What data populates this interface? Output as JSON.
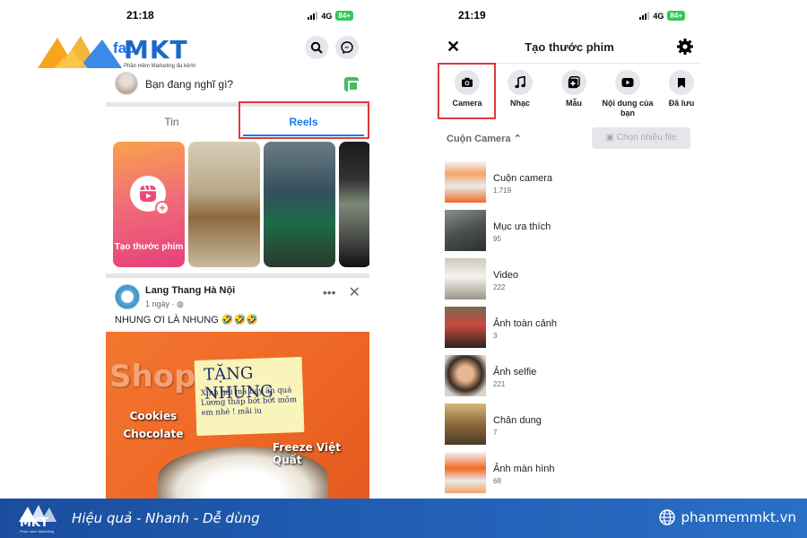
{
  "left_phone": {
    "status": {
      "time": "21:18",
      "network": "4G",
      "battery": "84+"
    },
    "brand": {
      "fb_text": "fac",
      "mkt_text": "MKT",
      "tagline": "Phần mềm Marketing đa kênh"
    },
    "composer": {
      "placeholder": "Bạn đang nghĩ gì?"
    },
    "tabs": [
      {
        "label": "Tin"
      },
      {
        "label": "Reels"
      }
    ],
    "reels": {
      "create_label": "Tạo thước phim"
    },
    "post": {
      "author": "Lang Thang Hà Nội",
      "time": "1 ngày · ",
      "caption": "NHUNG ƠI LÀ NHUNG 🤣🤣🤣",
      "image_text": {
        "brand": "Shope",
        "note_title": "TẶNG NHUNG",
        "note_body": "Xinh gái mà hay ăn quá Lương thấp bớt bớt mồm em nhé ! mãi iu",
        "cookies": "Cookies Chocolate",
        "freeze": "Freeze Việt Quất"
      }
    }
  },
  "right_phone": {
    "status": {
      "time": "21:19",
      "network": "4G",
      "battery": "84+"
    },
    "title": "Tạo thước phim",
    "categories": [
      {
        "label": "Camera",
        "icon": "camera-icon"
      },
      {
        "label": "Nhạc",
        "icon": "music-icon"
      },
      {
        "label": "Mẫu",
        "icon": "template-icon"
      },
      {
        "label": "Nội dung của bạn",
        "icon": "play-icon"
      },
      {
        "label": "Đã lưu",
        "icon": "bookmark-icon"
      }
    ],
    "filter": {
      "label": "Cuộn Camera",
      "multi_button": "Chọn nhiều file"
    },
    "albums": [
      {
        "name": "Cuộn camera",
        "count": "1.719"
      },
      {
        "name": "Mục ưa thích",
        "count": "95"
      },
      {
        "name": "Video",
        "count": "222"
      },
      {
        "name": "Ảnh toàn cảnh",
        "count": "3"
      },
      {
        "name": "Ảnh selfie",
        "count": "221"
      },
      {
        "name": "Chân dung",
        "count": "7"
      },
      {
        "name": "Ảnh màn hình",
        "count": "68"
      }
    ]
  },
  "footer": {
    "logo_text": "MKT",
    "logo_sub": "Phần mềm Marketing",
    "slogan": "Hiệu quả - Nhanh  - Dễ dùng",
    "website": "phanmemmkt.vn"
  },
  "colors": {
    "accent": "#1877f2",
    "highlight": "#e03a3a",
    "footer": "#1a4d9e"
  }
}
